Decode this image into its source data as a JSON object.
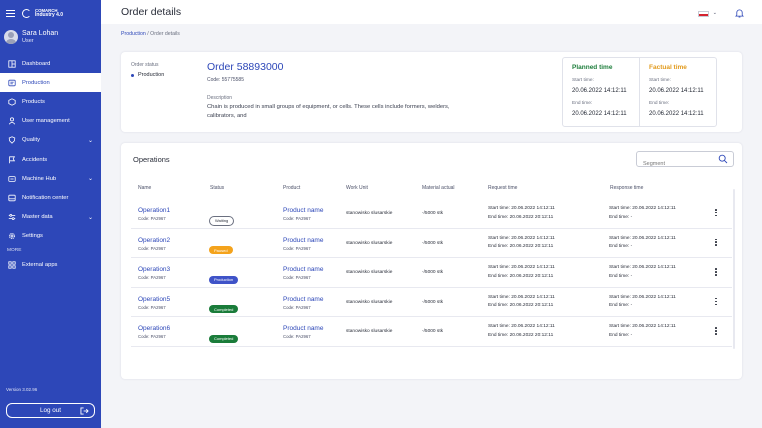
{
  "sidebar": {
    "logo": {
      "line1": "COMARCH",
      "line2": "Industry 4.0"
    },
    "user": {
      "name": "Sara Lohan",
      "role": "User"
    },
    "items": [
      {
        "label": "Dashboard"
      },
      {
        "label": "Production"
      },
      {
        "label": "Products"
      },
      {
        "label": "User management"
      },
      {
        "label": "Quality"
      },
      {
        "label": "Accidents"
      },
      {
        "label": "Machine Hub"
      },
      {
        "label": "Notification center"
      },
      {
        "label": "Master data"
      },
      {
        "label": "Settings"
      }
    ],
    "more_label": "MORE",
    "external": {
      "label": "External apps"
    },
    "version": "Version 3.02.96",
    "logout_label": "Log out"
  },
  "header": {
    "title": "Order details"
  },
  "breadcrumb": {
    "root": "Production",
    "sep": "/",
    "current": "Order details"
  },
  "summary": {
    "status_label": "Order status",
    "status_value": "Production",
    "order_title": "Order 58893000",
    "order_code": "Code: 55775585",
    "desc_label": "Description",
    "desc_text": "Chain is produced in small groups of equipment, or cells. These cells include formers, welders, calibrators, and",
    "planned": {
      "title": "Planned time",
      "start_label": "Start time:",
      "start": "20.06.2022 14:12:11",
      "end_label": "End time:",
      "end": "20.06.2022 14:12:11"
    },
    "factual": {
      "title": "Factual time",
      "start_label": "Start time:",
      "start": "20.06.2022 14:12:11",
      "end_label": "End time:",
      "end": "20.06.2022 14:12:11"
    },
    "colors": {
      "planned": "#1e7e3c",
      "factual": "#e29a1c"
    }
  },
  "operations": {
    "title": "Operations",
    "search_placeholder": "Segment",
    "headers": {
      "name": "Name",
      "status": "Status",
      "product": "Product",
      "work_unit": "Work Unit",
      "material": "Material actual",
      "request": "Request time",
      "response": "Response time"
    },
    "rows": [
      {
        "name": "Operation1",
        "code": "Code: PA2967",
        "status": "Waiting",
        "status_kind": "waiting",
        "product": "Product name",
        "product_code": "Code: PA2967",
        "work_unit": "stanowisko slusarskie",
        "material": "-/5000 stk",
        "req_start": "Start time: 20.06.2022 14:12:11",
        "req_end": "End time: 20.06.2022 20:12:11",
        "resp_start": "Start time: 20.06.2022 14:12:11",
        "resp_end": "End time: -"
      },
      {
        "name": "Operation2",
        "code": "Code: PA2967",
        "status": "Paused",
        "status_kind": "paused",
        "product": "Product name",
        "product_code": "Code: PA2967",
        "work_unit": "stanowisko slusarskie",
        "material": "-/5000 stk",
        "req_start": "Start time: 20.06.2022 14:12:11",
        "req_end": "End time: 20.06.2022 20:12:11",
        "resp_start": "Start time: 20.06.2022 14:12:11",
        "resp_end": "End time: -"
      },
      {
        "name": "Operation3",
        "code": "Code: PA2967",
        "status": "Production",
        "status_kind": "production",
        "product": "Product name",
        "product_code": "Code: PA2967",
        "work_unit": "stanowisko slusarskie",
        "material": "-/5000 stk",
        "req_start": "Start time: 20.06.2022 14:12:11",
        "req_end": "End time: 20.06.2022 20:12:11",
        "resp_start": "Start time: 20.06.2022 14:12:11",
        "resp_end": "End time: -"
      },
      {
        "name": "Operation5",
        "code": "Code: PA2967",
        "status": "Completed",
        "status_kind": "completed",
        "product": "Product name",
        "product_code": "Code: PA2967",
        "work_unit": "stanowisko slusarskie",
        "material": "-/5000 stk",
        "req_start": "Start time: 20.06.2022 14:12:11",
        "req_end": "End time: 20.06.2022 20:12:11",
        "resp_start": "Start time: 20.06.2022 14:12:11",
        "resp_end": "End time: -"
      },
      {
        "name": "Operation6",
        "code": "Code: PA2967",
        "status": "Completed",
        "status_kind": "completed",
        "product": "Product name",
        "product_code": "Code: PA2967",
        "work_unit": "stanowisko slusarskie",
        "material": "-/5000 stk",
        "req_start": "Start time: 20.06.2022 14:12:11",
        "req_end": "End time: 20.06.2022 20:12:11",
        "resp_start": "Start time: 20.06.2022 14:12:11",
        "resp_end": "End time: -"
      }
    ]
  },
  "colors": {
    "brand": "#2d47b8",
    "paused": "#f4a31c",
    "production": "#3f53c8",
    "completed": "#1a7c3a"
  },
  "icons": [
    "hamburger-icon",
    "logo-icon",
    "dashboard-icon",
    "production-icon",
    "products-icon",
    "user-icon",
    "quality-icon",
    "accidents-icon",
    "machine-hub-icon",
    "notification-icon",
    "master-data-icon",
    "settings-icon",
    "external-apps-icon",
    "logout-icon",
    "flag-icon",
    "bell-icon",
    "search-icon",
    "kebab-icon"
  ]
}
